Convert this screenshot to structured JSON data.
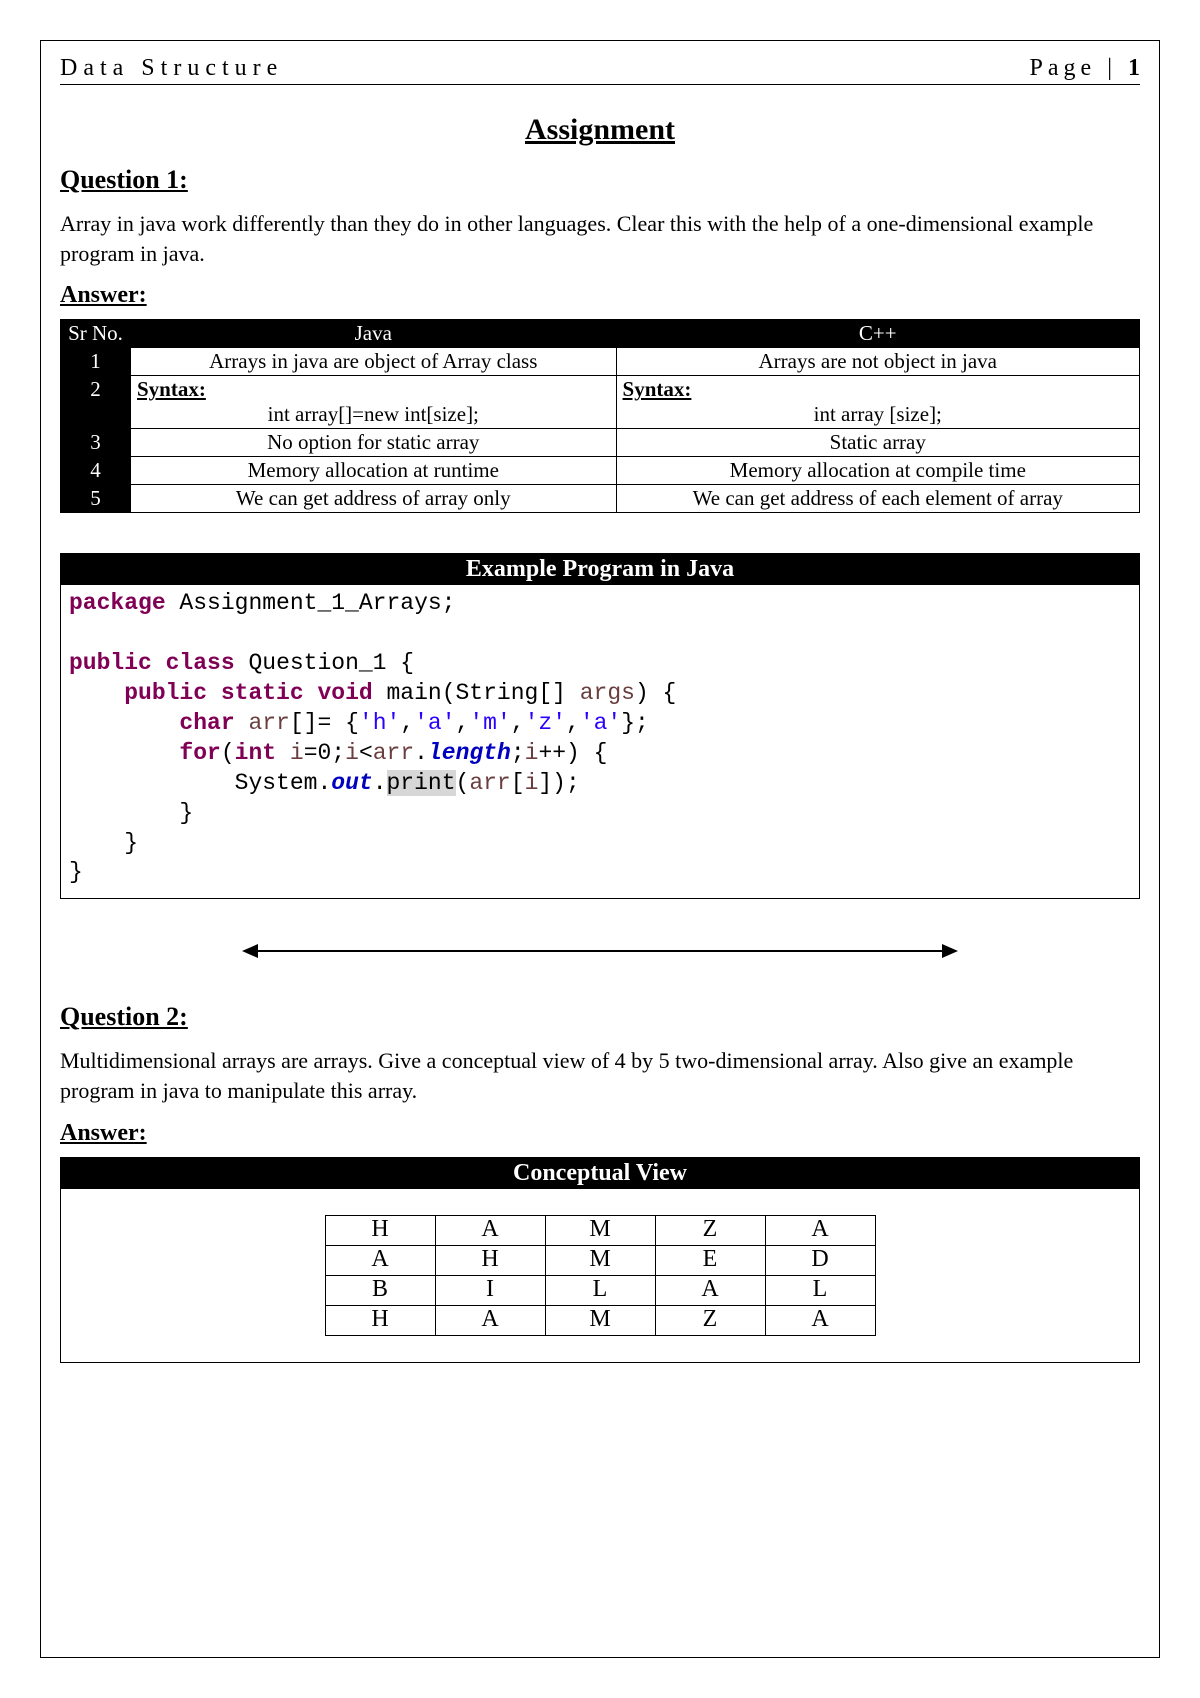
{
  "header": {
    "left": "Data Structure",
    "page_label": "Page",
    "page_sep": " | ",
    "page_num": "1"
  },
  "title": "Assignment",
  "q1_heading": "Question 1:",
  "q1_text": "Array in java work differently than they do in other languages. Clear this with the help of a one-dimensional example program in java.",
  "ans_heading": "Answer:",
  "cmp": {
    "headers": [
      "Sr No.",
      "Java",
      "C++"
    ],
    "rows": [
      {
        "sr": "1",
        "java": "Arrays in java are object of Array class",
        "cpp": "Arrays are not object in java"
      },
      {
        "sr": "2",
        "java_label": "Syntax:",
        "java_syntax": "int array[]=new int[size];",
        "cpp_label": "Syntax:",
        "cpp_syntax": "int array [size];"
      },
      {
        "sr": "3",
        "java": "No option for static array",
        "cpp": "Static array"
      },
      {
        "sr": "4",
        "java": "Memory allocation at runtime",
        "cpp": "Memory allocation at compile time"
      },
      {
        "sr": "5",
        "java": "We can get address of array only",
        "cpp": "We can get address of each element of array"
      }
    ]
  },
  "example_bar": "Example Program in Java",
  "code": {
    "l1_kw": "package",
    "l1_rest": " Assignment_1_Arrays;",
    "l3a": "public",
    "l3b": " class",
    "l3c": " Question_1 {",
    "l4a": "public",
    "l4b": " static",
    "l4c": " void",
    "l4d": " main(String[] ",
    "l4e": "args",
    "l4f": ") {",
    "l5a": "char",
    "l5b": " ",
    "l5c": "arr",
    "l5d": "[]= {",
    "l5e": "'h'",
    "l5f": ",",
    "l5g": "'a'",
    "l5h": ",",
    "l5i": "'m'",
    "l5j": ",",
    "l5k": "'z'",
    "l5l": ",",
    "l5m": "'a'",
    "l5n": "};",
    "l6a": "for",
    "l6b": "(",
    "l6c": "int",
    "l6d": " ",
    "l6e": "i",
    "l6f": "=0;",
    "l6g": "i",
    "l6h": "<",
    "l6i": "arr",
    "l6j": ".",
    "l6k": "length",
    "l6l": ";",
    "l6m": "i",
    "l6n": "++) {",
    "l7a": "System.",
    "l7b": "out",
    "l7c": ".",
    "l7d": "print",
    "l7e": "(",
    "l7f": "arr",
    "l7g": "[",
    "l7h": "i",
    "l7i": "]);",
    "l8": "}",
    "l9": "}",
    "l10": "}"
  },
  "q2_heading": "Question 2:",
  "q2_text": "Multidimensional arrays are arrays. Give a conceptual view of 4 by 5 two-dimensional array. Also give an example program in java to manipulate this array.",
  "cv_bar": "Conceptual View",
  "grid": [
    [
      "H",
      "A",
      "M",
      "Z",
      "A"
    ],
    [
      "A",
      "H",
      "M",
      "E",
      "D"
    ],
    [
      "B",
      "I",
      "L",
      "A",
      "L"
    ],
    [
      "H",
      "A",
      "M",
      "Z",
      "A"
    ]
  ]
}
